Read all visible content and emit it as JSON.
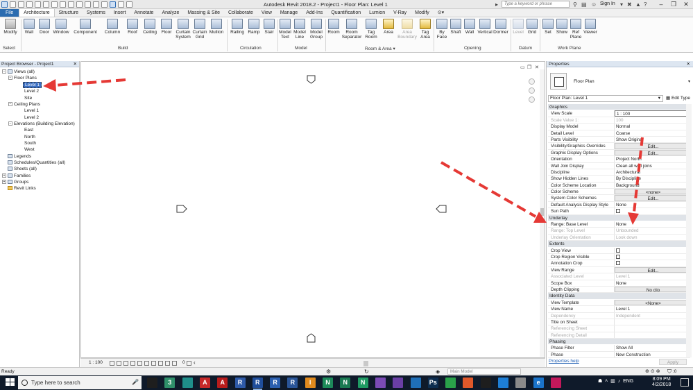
{
  "app": {
    "title": "Autodesk Revit 2018.2 -    Project1 - Floor Plan: Level 1",
    "search_placeholder": "Type a keyword or phrase",
    "sign_in": "Sign In"
  },
  "ribbon_tabs": [
    "File",
    "Architecture",
    "Structure",
    "Systems",
    "Insert",
    "Annotate",
    "Analyze",
    "Massing & Site",
    "Collaborate",
    "View",
    "Manage",
    "Add-Ins",
    "Quantification",
    "Lumion",
    "V-Ray",
    "Modify"
  ],
  "ribbon": {
    "modify": "Modify",
    "select": "Select",
    "build": [
      "Wall",
      "Door",
      "Window",
      "Component",
      "Column",
      "Roof",
      "Ceiling",
      "Floor",
      "Curtain System",
      "Curtain Grid",
      "Mullion"
    ],
    "build_label": "Build",
    "circulation": [
      "Railing",
      "Ramp",
      "Stair"
    ],
    "circulation_label": "Circulation",
    "model": [
      "Model Text",
      "Model Line",
      "Model Group"
    ],
    "model_label": "Model",
    "room_area": [
      "Room",
      "Room Separator",
      "Tag Room",
      "Area",
      "Area Boundary",
      "Tag Area"
    ],
    "room_area_label": "Room & Area",
    "opening": [
      "By Face",
      "Shaft",
      "Wall",
      "Vertical",
      "Dormer"
    ],
    "opening_label": "Opening",
    "datum": [
      "Level",
      "Grid"
    ],
    "datum_label": "Datum",
    "work_plane": [
      "Set",
      "Show",
      "Ref Plane",
      "Viewer"
    ],
    "work_plane_label": "Work Plane"
  },
  "project_browser": {
    "title": "Project Browser - Project1",
    "items": [
      {
        "label": "Views (all)"
      },
      {
        "label": "Floor Plans"
      },
      {
        "label": "Level 1"
      },
      {
        "label": "Level 2"
      },
      {
        "label": "Site"
      },
      {
        "label": "Ceiling Plans"
      },
      {
        "label": "Level 1"
      },
      {
        "label": "Level 2"
      },
      {
        "label": "Elevations (Building Elevation)"
      },
      {
        "label": "East"
      },
      {
        "label": "North"
      },
      {
        "label": "South"
      },
      {
        "label": "West"
      },
      {
        "label": "Legends"
      },
      {
        "label": "Schedules/Quantities (all)"
      },
      {
        "label": "Sheets (all)"
      },
      {
        "label": "Families"
      },
      {
        "label": "Groups"
      },
      {
        "label": "Revit Links"
      }
    ]
  },
  "view_control": {
    "scale": "1 : 100",
    "count": "0"
  },
  "properties": {
    "title": "Properties",
    "type_name": "Floor Plan",
    "instance": "Floor Plan: Level 1",
    "edit_type": "Edit Type",
    "help": "Properties help",
    "apply": "Apply",
    "groups": [
      {
        "name": "Graphics",
        "rows": [
          {
            "k": "View Scale",
            "v": "1 : 100",
            "style": "input"
          },
          {
            "k": "Scale Value    1:",
            "v": "100",
            "style": "ro"
          },
          {
            "k": "Display Model",
            "v": "Normal"
          },
          {
            "k": "Detail Level",
            "v": "Coarse"
          },
          {
            "k": "Parts Visibility",
            "v": "Show Original"
          },
          {
            "k": "Visibility/Graphics Overrides",
            "v": "Edit...",
            "style": "btn"
          },
          {
            "k": "Graphic Display Options",
            "v": "Edit...",
            "style": "btn"
          },
          {
            "k": "Orientation",
            "v": "Project North"
          },
          {
            "k": "Wall Join Display",
            "v": "Clean all wall joins"
          },
          {
            "k": "Discipline",
            "v": "Architectural"
          },
          {
            "k": "Show Hidden Lines",
            "v": "By Discipline"
          },
          {
            "k": "Color Scheme Location",
            "v": "Background"
          },
          {
            "k": "Color Scheme",
            "v": "<none>",
            "style": "btn"
          },
          {
            "k": "System Color Schemes",
            "v": "Edit...",
            "style": "btn"
          },
          {
            "k": "Default Analysis Display Style",
            "v": "None"
          },
          {
            "k": "Sun Path",
            "v": "",
            "style": "cb"
          }
        ]
      },
      {
        "name": "Underlay",
        "rows": [
          {
            "k": "Range: Base Level",
            "v": "None"
          },
          {
            "k": "Range: Top Level",
            "v": "Unbounded",
            "style": "ro"
          },
          {
            "k": "Underlay Orientation",
            "v": "Look down",
            "style": "ro"
          }
        ]
      },
      {
        "name": "Extents",
        "rows": [
          {
            "k": "Crop View",
            "v": "",
            "style": "cb"
          },
          {
            "k": "Crop Region Visible",
            "v": "",
            "style": "cb"
          },
          {
            "k": "Annotation Crop",
            "v": "",
            "style": "cb"
          },
          {
            "k": "View Range",
            "v": "Edit...",
            "style": "btn"
          },
          {
            "k": "Associated Level",
            "v": "Level 1",
            "style": "ro"
          },
          {
            "k": "Scope Box",
            "v": "None"
          },
          {
            "k": "Depth Clipping",
            "v": "No clip",
            "style": "btn"
          }
        ]
      },
      {
        "name": "Identity Data",
        "rows": [
          {
            "k": "View Template",
            "v": "<None>",
            "style": "btn"
          },
          {
            "k": "View Name",
            "v": "Level 1"
          },
          {
            "k": "Dependency",
            "v": "Independent",
            "style": "ro"
          },
          {
            "k": "Title on Sheet",
            "v": ""
          },
          {
            "k": "Referencing Sheet",
            "v": "",
            "style": "ro"
          },
          {
            "k": "Referencing Detail",
            "v": "",
            "style": "ro"
          }
        ]
      },
      {
        "name": "Phasing",
        "rows": [
          {
            "k": "Phase Filter",
            "v": "Show All"
          },
          {
            "k": "Phase",
            "v": "New Construction"
          }
        ]
      }
    ]
  },
  "status": {
    "text": "Ready",
    "workset": "Main Model",
    "filter": ":0"
  },
  "taskbar": {
    "search_placeholder": "Type here to search",
    "apps": [
      {
        "letter": "",
        "color": "#1e1e1e"
      },
      {
        "letter": "3",
        "color": "#2f8f6a"
      },
      {
        "letter": "",
        "color": "#1f8e8a"
      },
      {
        "letter": "A",
        "color": "#c62828"
      },
      {
        "letter": "A",
        "color": "#b71c1c"
      },
      {
        "letter": "R",
        "color": "#2e5aa8"
      },
      {
        "letter": "R",
        "color": "#1f4e9c"
      },
      {
        "letter": "R",
        "color": "#2b5fb0"
      },
      {
        "letter": "R",
        "color": "#2a5598"
      },
      {
        "letter": "I",
        "color": "#e08a1e"
      },
      {
        "letter": "N",
        "color": "#1d8a5a"
      },
      {
        "letter": "N",
        "color": "#1a7a52"
      },
      {
        "letter": "N",
        "color": "#1f9a63"
      },
      {
        "letter": "",
        "color": "#7b4bb5"
      },
      {
        "letter": "",
        "color": "#6a3fa5"
      },
      {
        "letter": "",
        "color": "#1f6fb8"
      },
      {
        "letter": "Ps",
        "color": "#0d2d4f"
      },
      {
        "letter": "",
        "color": "#2aa04a"
      },
      {
        "letter": "",
        "color": "#e0582a"
      },
      {
        "letter": "",
        "color": "#1e1e1e"
      },
      {
        "letter": "",
        "color": "#1d7ed6"
      },
      {
        "letter": "",
        "color": "#8a8a8a"
      },
      {
        "letter": "e",
        "color": "#1a73c9"
      },
      {
        "letter": "",
        "color": "#c2185b"
      }
    ],
    "lang": "ENG",
    "time": "8:09 PM",
    "date": "4/2/2018"
  },
  "colors": {
    "accent": "#2b6cb0",
    "annotation": "#e53935",
    "selection": "#3b6fc2"
  }
}
